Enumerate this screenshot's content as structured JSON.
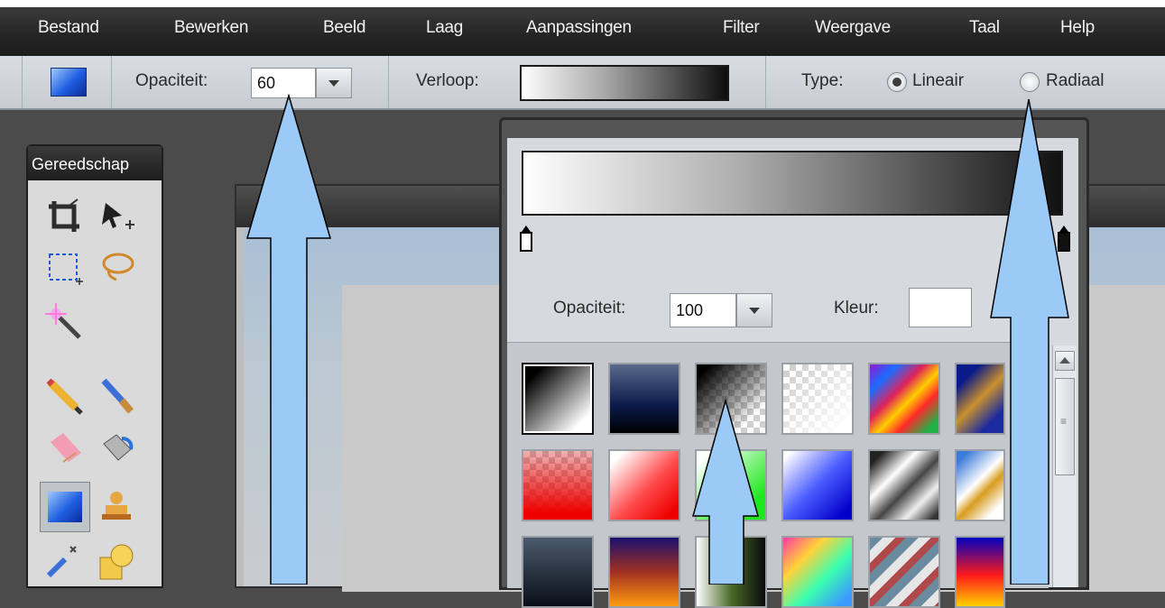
{
  "menu": [
    "Bestand",
    "Bewerken",
    "Beeld",
    "Laag",
    "Aanpassingen",
    "Filter",
    "Weergave",
    "Taal",
    "Help"
  ],
  "options": {
    "opacity_label": "Opaciteit:",
    "opacity_value": "60",
    "gradient_label": "Verloop:",
    "type_label": "Type:",
    "type_linear": "Lineair",
    "type_radial": "Radiaal",
    "selected_type": "Lineair"
  },
  "tools_panel": {
    "title": "Gereedschap"
  },
  "popup": {
    "opacity_label": "Opaciteit:",
    "opacity_value": "100",
    "color_label": "Kleur:"
  },
  "colors": {
    "accent_arrow": "#9ccaf6",
    "menu_bg": "#262626"
  }
}
